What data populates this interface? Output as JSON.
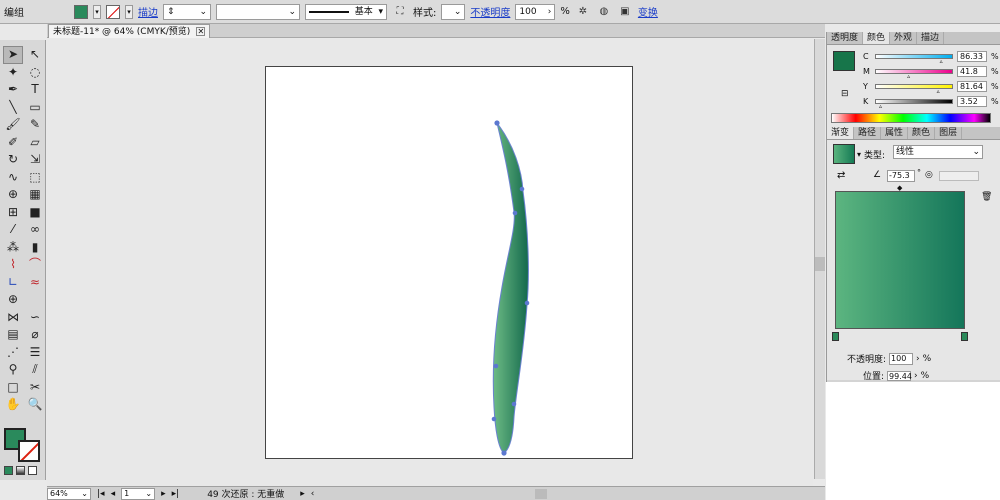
{
  "control_bar": {
    "group_label": "编组",
    "stroke_link": "描边",
    "stroke_weight": "",
    "brush_style": "基本",
    "style_label": "样式:",
    "opacity_link": "不透明度",
    "opacity_value": "100",
    "opacity_unit": "%",
    "transform_link": "变换",
    "colors": {
      "fill": "#2a8a5c"
    }
  },
  "document": {
    "tab_title": "未标题-11* @ 64% (CMYK/预览)",
    "close_glyph": "✕"
  },
  "toolbox": {
    "tools": [
      {
        "icon": "selection-tool-icon",
        "glyph": "➤"
      },
      {
        "icon": "direct-selection-tool-icon",
        "glyph": "↖"
      },
      {
        "icon": "magic-wand-tool-icon",
        "glyph": "✦"
      },
      {
        "icon": "lasso-tool-icon",
        "glyph": "◌"
      },
      {
        "icon": "pen-tool-icon",
        "glyph": "✒"
      },
      {
        "icon": "type-tool-icon",
        "glyph": "T"
      },
      {
        "icon": "line-tool-icon",
        "glyph": "╲"
      },
      {
        "icon": "rectangle-tool-icon",
        "glyph": "▭"
      },
      {
        "icon": "paintbrush-tool-icon",
        "glyph": "🖌"
      },
      {
        "icon": "pencil-tool-icon",
        "glyph": "✎"
      },
      {
        "icon": "blob-brush-tool-icon",
        "glyph": "✐"
      },
      {
        "icon": "eraser-tool-icon",
        "glyph": "▱"
      },
      {
        "icon": "rotate-tool-icon",
        "glyph": "↻"
      },
      {
        "icon": "scale-tool-icon",
        "glyph": "⇲"
      },
      {
        "icon": "warp-tool-icon",
        "glyph": "∿"
      },
      {
        "icon": "free-transform-tool-icon",
        "glyph": "⬚"
      },
      {
        "icon": "shape-builder-tool-icon",
        "glyph": "⊕"
      },
      {
        "icon": "perspective-grid-tool-icon",
        "glyph": "▦"
      },
      {
        "icon": "mesh-tool-icon",
        "glyph": "⊞"
      },
      {
        "icon": "gradient-tool-icon",
        "glyph": "■"
      },
      {
        "icon": "eyedropper-tool-icon",
        "glyph": "⁄"
      },
      {
        "icon": "blend-tool-icon",
        "glyph": "∞"
      },
      {
        "icon": "symbol-sprayer-tool-icon",
        "glyph": "⁂"
      },
      {
        "icon": "column-graph-tool-icon",
        "glyph": "▮"
      },
      {
        "icon": "anchor-red-tool-icon",
        "glyph": "⌇"
      },
      {
        "icon": "curve-red-tool-icon",
        "glyph": "⌒"
      },
      {
        "icon": "path-blue-tool-icon",
        "glyph": "∟"
      },
      {
        "icon": "wave-red-tool-icon",
        "glyph": "≈"
      },
      {
        "icon": "crosshair-tool-icon",
        "glyph": "⊕"
      },
      {
        "icon": "blank-tool-icon",
        "glyph": ""
      },
      {
        "icon": "bow-tie-tool-icon",
        "glyph": "⋈"
      },
      {
        "icon": "wave-tool-icon",
        "glyph": "∽"
      },
      {
        "icon": "grid-tool-icon",
        "glyph": "▤"
      },
      {
        "icon": "twirl-tool-icon",
        "glyph": "⌀"
      },
      {
        "icon": "scatter-tool-icon",
        "glyph": "⋰"
      },
      {
        "icon": "list-tool-icon",
        "glyph": "☰"
      },
      {
        "icon": "slice-tool-icon",
        "glyph": "⚲"
      },
      {
        "icon": "knife-tool-icon",
        "glyph": "⫽"
      },
      {
        "icon": "artboard-tool-icon",
        "glyph": "□"
      },
      {
        "icon": "scissors-tool-icon",
        "glyph": "✂"
      },
      {
        "icon": "hand-tool-icon",
        "glyph": "✋"
      },
      {
        "icon": "zoom-tool-icon",
        "glyph": "🔍"
      }
    ],
    "fill_color": "#2a8a5c"
  },
  "status_bar": {
    "zoom": "64%",
    "artboard_number": "1",
    "history_text": "49 次还原 : 无重做"
  },
  "color_panel": {
    "tabs": [
      "透明度",
      "颜色",
      "外观",
      "描边"
    ],
    "active_tab": "颜色",
    "swatch_color": "#17754a",
    "channels": [
      {
        "name": "C",
        "value": "86.33",
        "gradient": "#ffffff,#00aeef",
        "marker": 0.86
      },
      {
        "name": "M",
        "value": "41.8",
        "gradient": "#ffffff,#ec008c",
        "marker": 0.42
      },
      {
        "name": "Y",
        "value": "81.64",
        "gradient": "#ffffff,#fff200",
        "marker": 0.82
      },
      {
        "name": "K",
        "value": "3.52",
        "gradient": "#ffffff,#000000",
        "marker": 0.04
      }
    ],
    "percent": "%"
  },
  "gradient_panel": {
    "tabs": [
      "渐变",
      "路径",
      "属性",
      "颜色",
      "图层"
    ],
    "active_tab": "渐变",
    "type_label": "类型:",
    "type_value": "线性",
    "angle_value": "-75.3",
    "angle_unit": "°",
    "start_color": "#5cb580",
    "end_color": "#14765a",
    "opacity_label": "不透明度:",
    "opacity_value": "100",
    "location_label": "位置:",
    "location_value": "99.44",
    "percent": "%"
  }
}
